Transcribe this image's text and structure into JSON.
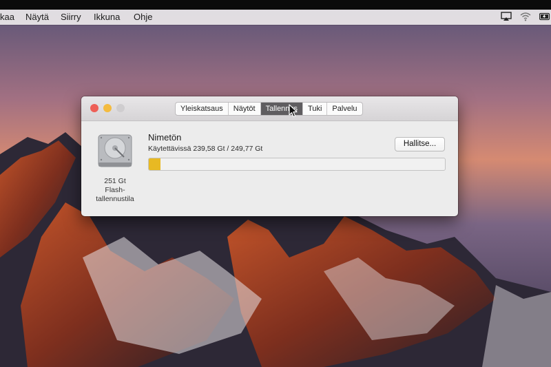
{
  "menubar": {
    "items": [
      "kaa",
      "Näytä",
      "Siirry",
      "Ikkuna",
      "Ohje"
    ],
    "status_icons": [
      "airplay-icon",
      "wifi-icon",
      "battery-icon"
    ]
  },
  "window": {
    "tabs": [
      {
        "label": "Yleiskatsaus",
        "active": false
      },
      {
        "label": "Näytöt",
        "active": false
      },
      {
        "label": "Tallennus",
        "active": true
      },
      {
        "label": "Tuki",
        "active": false
      },
      {
        "label": "Palvelu",
        "active": false
      }
    ],
    "disk": {
      "icon": "hard-disk-icon",
      "caption_lines": [
        "251 Gt",
        "Flash-",
        "tallennustila"
      ]
    },
    "volume": {
      "name": "Nimetön",
      "available": "Käytettävissä 239,58 Gt / 249,77 Gt",
      "usage_fraction": 0.04,
      "usage_color": "#e8b923"
    },
    "manage_button": "Hallitse..."
  },
  "colors": {
    "close": "#ee5f57",
    "minimize": "#f4bb3f",
    "zoom_inactive": "#cfcdcf"
  }
}
